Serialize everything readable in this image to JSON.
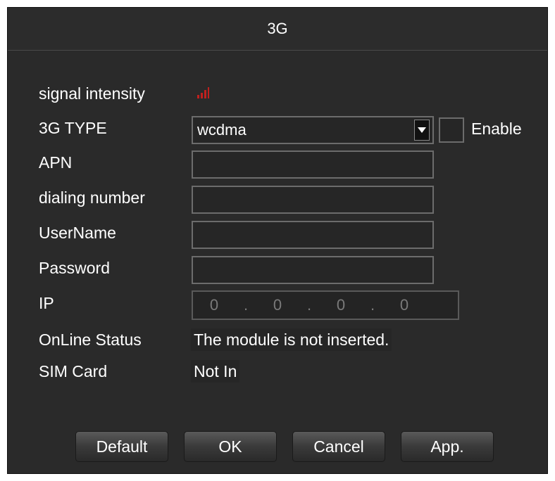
{
  "window": {
    "title": "3G"
  },
  "labels": {
    "signal_intensity": "signal intensity",
    "type": "3G TYPE",
    "apn": "APN",
    "dialing_number": "dialing number",
    "username": "UserName",
    "password": "Password",
    "ip": "IP",
    "online_status": "OnLine Status",
    "sim_card": "SIM Card"
  },
  "fields": {
    "type_value": "wcdma",
    "enable_label": "Enable",
    "enable_checked": false,
    "apn_value": "",
    "dialing_number_value": "",
    "username_value": "",
    "password_value": "",
    "ip": [
      "0",
      "0",
      "0",
      "0"
    ],
    "ip_separator": ".",
    "online_status_value": "The module is not inserted.",
    "sim_card_value": "Not In"
  },
  "signal": {
    "color": "#c0201e"
  },
  "buttons": {
    "default": "Default",
    "ok": "OK",
    "cancel": "Cancel",
    "apply": "App."
  }
}
